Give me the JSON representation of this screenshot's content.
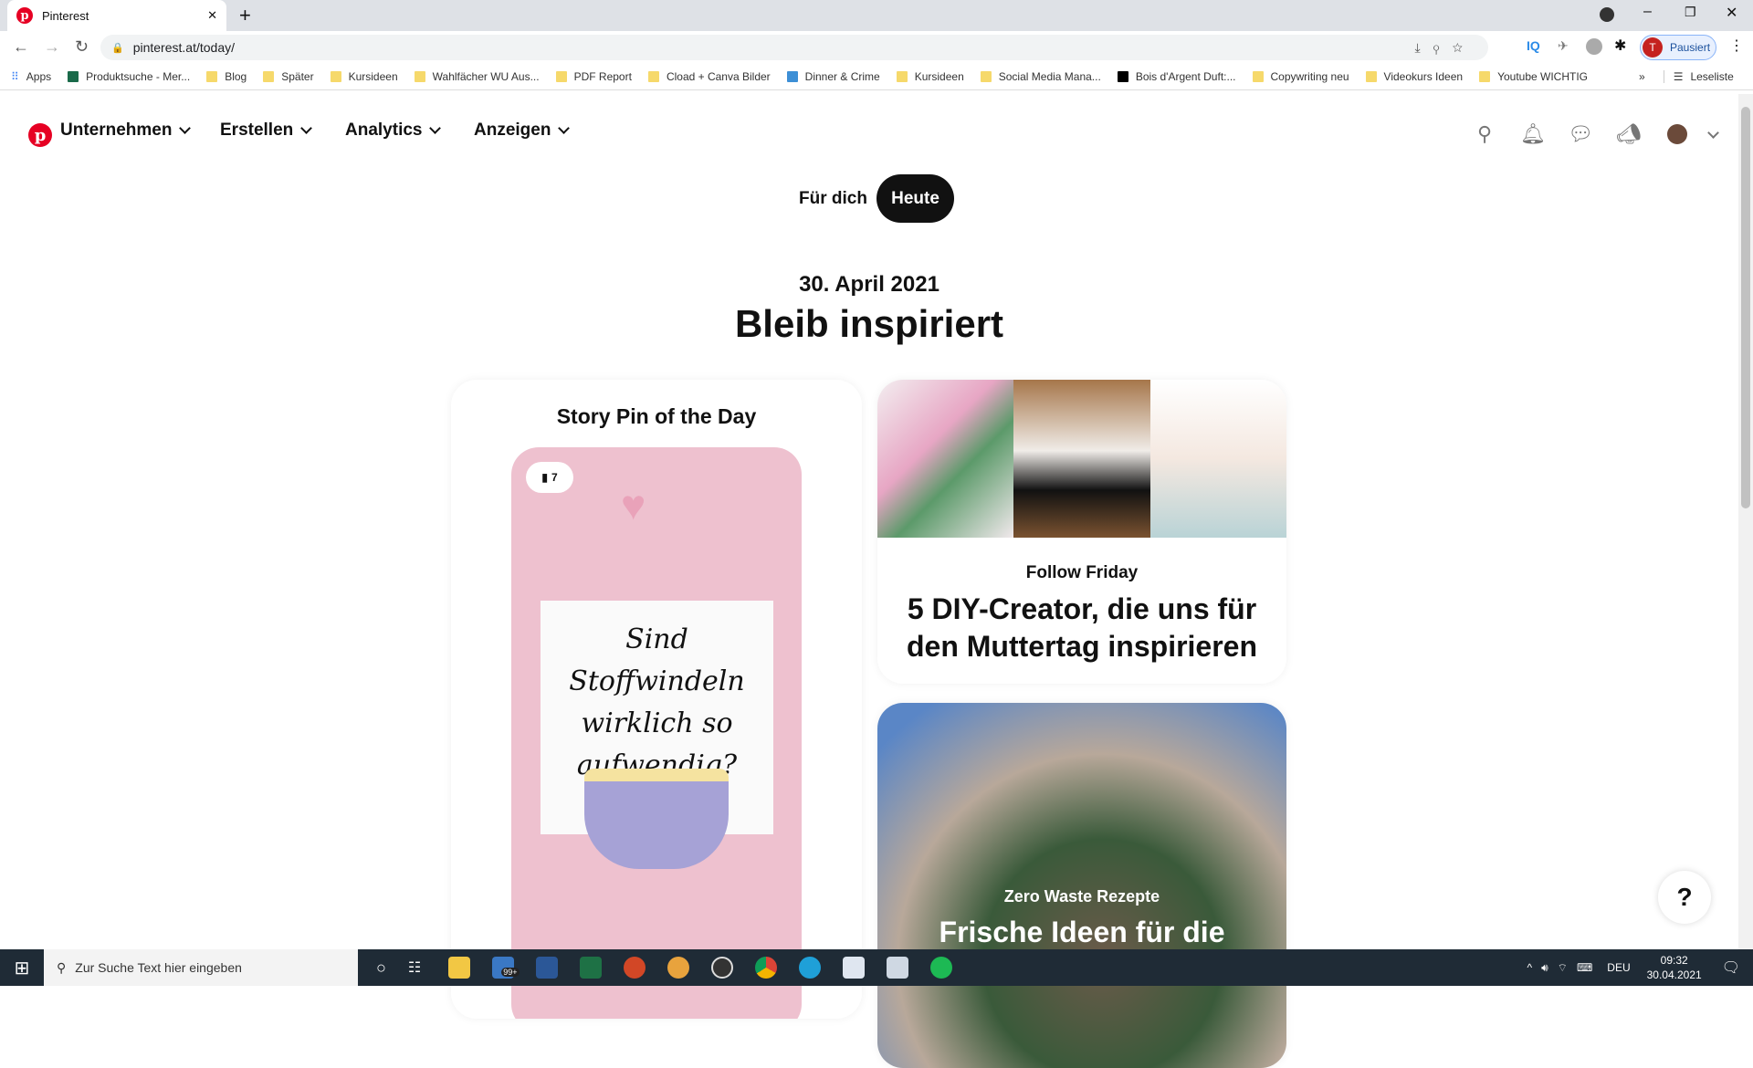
{
  "browser": {
    "tab_title": "Pinterest",
    "url": "pinterest.at/today/",
    "profile_label": "Pausiert",
    "profile_initial": "T",
    "bookmarks": [
      "Apps",
      "Produktsuche - Mer...",
      "Blog",
      "Später",
      "Kursideen",
      "Wahlfächer WU Aus...",
      "PDF Report",
      "Cload + Canva Bilder",
      "Dinner & Crime",
      "Kursideen",
      "Social Media Mana...",
      "Bois d'Argent Duft:...",
      "Copywriting neu",
      "Videokurs Ideen",
      "Youtube WICHTIG"
    ],
    "reading_list": "Leseliste",
    "more": "»"
  },
  "nav": {
    "items": [
      "Unternehmen",
      "Erstellen",
      "Analytics",
      "Anzeigen"
    ]
  },
  "tabs": {
    "for_you": "Für dich",
    "today": "Heute"
  },
  "today": {
    "date": "30. April 2021",
    "title": "Bleib inspiriert",
    "story": {
      "heading": "Story Pin of the Day",
      "page_count": "7",
      "pin_text": "Sind Stoffwindeln wirklich so aufwendig?"
    },
    "card1": {
      "kicker": "Follow Friday",
      "title": "5 DIY-Creator, die uns für den Muttertag inspirieren"
    },
    "card2": {
      "kicker": "Zero Waste Rezepte",
      "title": "Frische Ideen für die"
    }
  },
  "help": "?",
  "taskbar": {
    "search_placeholder": "Zur Suche Text hier eingeben",
    "mail_badge": "99+",
    "lang": "DEU",
    "time": "09:32",
    "date": "30.04.2021"
  },
  "colors": {
    "brand": "#e60023",
    "pill": "#111111",
    "taskbar": "#1f2b36",
    "pin_pink": "#eec1cf"
  }
}
